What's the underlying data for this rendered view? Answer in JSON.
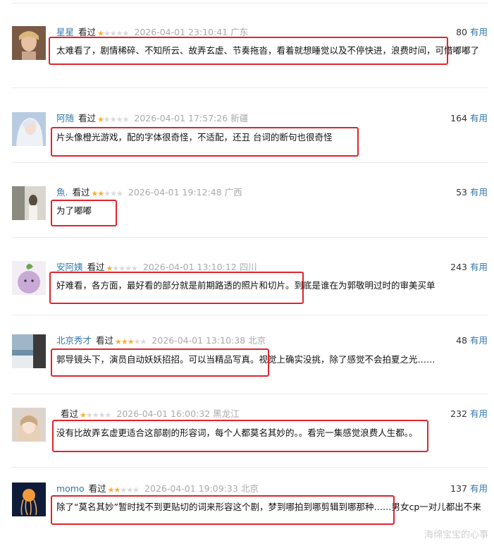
{
  "reviews": [
    {
      "user": "星星",
      "status": "看过",
      "rating": 1,
      "time": "2026-04-01 23:10:41",
      "location": "广东",
      "votes": "80",
      "useful": "有用",
      "content": "太难看了，剧情稀碎、不知所云、故弄玄虚、节奏拖沓，看着就想睡觉以及不停快进，浪费时间，可惜嘟嘟了"
    },
    {
      "user": "阿随",
      "status": "看过",
      "rating": 1,
      "time": "2026-04-01 17:57:26",
      "location": "新疆",
      "votes": "164",
      "useful": "有用",
      "content": "片头像橙光游戏，配的字体很奇怪，不适配，还丑 台词的断句也很奇怪"
    },
    {
      "user": "魚.",
      "status": "看过",
      "rating": 2,
      "time": "2026-04-01 19:12:48",
      "location": "广西",
      "votes": "53",
      "useful": "有用",
      "content": "为了嘟嘟"
    },
    {
      "user": "安阿姨",
      "status": "看过",
      "rating": 1,
      "time": "2026-04-01 13:10:12",
      "location": "四川",
      "votes": "243",
      "useful": "有用",
      "content": "好难看，各方面，最好看的部分就是前期路透的照片和切片。到底是谁在为郭敬明过时的审美买单"
    },
    {
      "user": "北京秀才",
      "status": "看过",
      "rating": 3,
      "time": "2026-04-01 13:10:38",
      "location": "北京",
      "votes": "48",
      "useful": "有用",
      "content": "郭导镜头下，演员自动妖妖招招。可以当精品写真。视觉上确实没挑，除了感觉不会拍夏之光……"
    },
    {
      "user": "",
      "status": "看过",
      "rating": 1,
      "time": "2026-04-01 16:00:32",
      "location": "黑龙江",
      "votes": "232",
      "useful": "有用",
      "content": "没有比故弄玄虚更适合这部剧的形容词，每个人都莫名其妙的。。看完一集感觉浪费人生都。。"
    },
    {
      "user": "momo",
      "status": "看过",
      "rating": 2,
      "time": "2026-04-01 19:09:33",
      "location": "北京",
      "votes": "137",
      "useful": "有用",
      "content": "除了“莫名其妙”暂时找不到更贴切的词来形容这个剧，梦到哪拍到哪剪辑到哪那种……男女cp一对儿都出不来"
    }
  ],
  "watermark": "海绵宝宝的心事",
  "colors": {
    "username": "#3377aa",
    "star": "#ffac2d",
    "highlight": "#e0242d",
    "meta": "#aaaaaa"
  }
}
